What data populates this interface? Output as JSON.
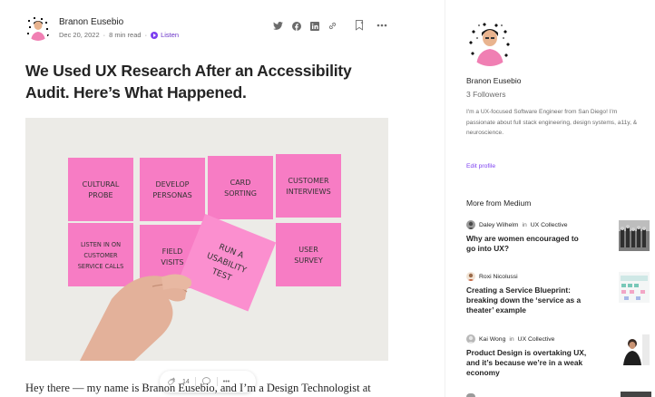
{
  "article": {
    "author": "Branon Eusebio",
    "date": "Dec 20, 2022",
    "read_time": "8 min read",
    "listen_label": "Listen",
    "separator": "·",
    "title": "We Used UX Research After an Accessibility Audit. Here’s What Happened.",
    "clap_count": "14",
    "more_label": "•••",
    "body_start": "Hey there — my name is Branon Eusebio, and I’m a Design Technologist at",
    "share_icons": [
      "twitter-icon",
      "facebook-icon",
      "linkedin-icon",
      "link-icon"
    ]
  },
  "hero_image": {
    "notes": [
      {
        "text": [
          "CULTURAL",
          "PROBE"
        ]
      },
      {
        "text": [
          "DEVELOP",
          "PERSONAS"
        ]
      },
      {
        "text": [
          "CARD",
          "SORTING"
        ]
      },
      {
        "text": [
          "CUSTOMER",
          "INTERVIEWS"
        ]
      },
      {
        "text": [
          "LISTEN IN ON",
          "CUSTOMER",
          "SERVICE CALLS"
        ]
      },
      {
        "text": [
          "FIELD",
          "VISITS"
        ]
      },
      {
        "text": [
          "USER",
          "SURVEY"
        ]
      }
    ],
    "held_note": [
      "RUN A",
      "USABILITY",
      "TEST"
    ],
    "colors": {
      "note": "#f77cc4",
      "note_held": "#fb8fcf",
      "background": "#ecebe7",
      "ink": "#333333"
    }
  },
  "sidebar": {
    "name": "Branon Eusebio",
    "followers": "3 Followers",
    "bio": "I'm a UX-focused Software Engineer from San Diego! I'm passionate about full stack engineering, design systems, a11y, & neuroscience.",
    "edit_profile": "Edit profile",
    "more_from_title": "More from Medium",
    "in_label": "in",
    "stories": [
      {
        "author": "Daley Wilhelm",
        "publication": "UX Collective",
        "title": "Why are women encouraged to go into UX?"
      },
      {
        "author": "Roxi Nicolussi",
        "publication": "",
        "title": "Creating a Service Blueprint: breaking down the ‘service as a theater’ example"
      },
      {
        "author": "Kai Wong",
        "publication": "UX Collective",
        "title": "Product Design is overtaking UX, and it’s because we’re in a weak economy"
      }
    ]
  },
  "colors": {
    "accent": "#7c3ff0",
    "text": "#242424",
    "muted": "#6b6b6b"
  }
}
